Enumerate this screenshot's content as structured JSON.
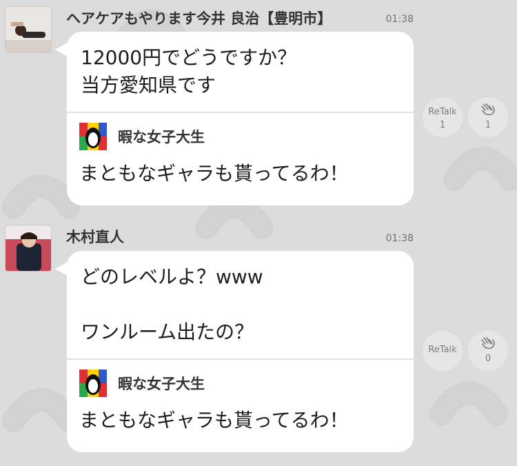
{
  "posts": [
    {
      "username": "ヘアケアもやります今井 良治【豊明市】",
      "time": "01:38",
      "text": "12000円でどうですか？\n当方愛知県です",
      "quote": {
        "name": "暇な女子大生",
        "text": "まともなギャラも貰ってるわ！"
      },
      "retalk_label": "ReTalk",
      "retalk_count": "1",
      "clap_count": "1"
    },
    {
      "username": "木村直人",
      "time": "01:38",
      "text": "どのレベルよ？www\n\nワンルーム出たの？",
      "quote": {
        "name": "暇な女子大生",
        "text": "まともなギャラも貰ってるわ！"
      },
      "retalk_label": "ReTalk",
      "retalk_count": "",
      "clap_count": "0"
    }
  ],
  "colors": {
    "background": "#dcdcdc",
    "bubble": "#ffffff",
    "action_button": "#e6e6e6"
  },
  "icons": {
    "retalk": "retalk-button",
    "clap": "clap-icon"
  }
}
